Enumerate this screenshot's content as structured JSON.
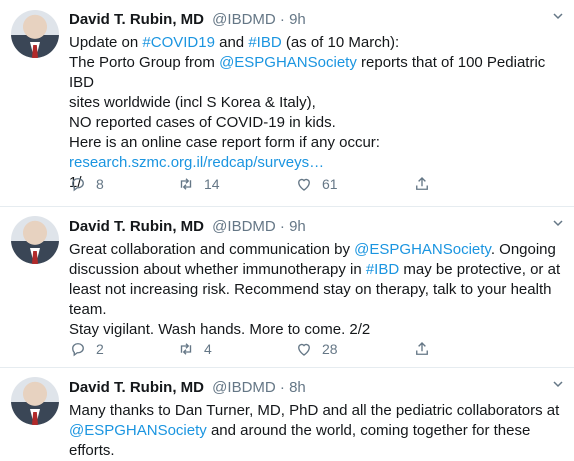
{
  "tweets": [
    {
      "author": "David T. Rubin, MD",
      "handle": "@IBDMD",
      "separator": "·",
      "time": "9h",
      "lines": [
        [
          {
            "t": "Update on "
          },
          {
            "t": "#COVID19",
            "link": true
          },
          {
            "t": " and "
          },
          {
            "t": "#IBD",
            "link": true
          },
          {
            "t": " (as of 10 March):"
          }
        ],
        [
          {
            "t": "The Porto Group from "
          },
          {
            "t": "@ESPGHANSociety",
            "link": true
          },
          {
            "t": " reports that of 100 Pediatric IBD"
          }
        ],
        [
          {
            "t": "sites worldwide (incl S Korea & Italy),"
          }
        ],
        [
          {
            "t": "NO reported cases of COVID-19 in kids."
          }
        ],
        [
          {
            "t": "Here is an online case report form if any occur:"
          }
        ],
        [
          {
            "t": "research.szmc.org.il/redcap/surveys…",
            "link": true
          }
        ],
        [
          {
            "t": "1/"
          }
        ]
      ],
      "replies": "8",
      "retweets": "14",
      "likes": "61"
    },
    {
      "author": "David T. Rubin, MD",
      "handle": "@IBDMD",
      "separator": "·",
      "time": "9h",
      "lines": [
        [
          {
            "t": "Great collaboration and communication by "
          },
          {
            "t": "@ESPGHANSociety",
            "link": true
          },
          {
            "t": ". Ongoing"
          }
        ],
        [
          {
            "t": "discussion about whether immunotherapy in "
          },
          {
            "t": "#IBD",
            "link": true
          },
          {
            "t": " may be protective, or at"
          }
        ],
        [
          {
            "t": "least not increasing risk. Recommend stay on therapy, talk to your health"
          }
        ],
        [
          {
            "t": "team."
          }
        ],
        [
          {
            "t": "Stay vigilant. Wash hands. More to come. 2/2"
          }
        ]
      ],
      "replies": "2",
      "retweets": "4",
      "likes": "28"
    },
    {
      "author": "David T. Rubin, MD",
      "handle": "@IBDMD",
      "separator": "·",
      "time": "8h",
      "lines": [
        [
          {
            "t": "Many thanks to Dan Turner, MD, PhD and all the pediatric collaborators at"
          }
        ],
        [
          {
            "t": "@ESPGHANSociety",
            "link": true
          },
          {
            "t": " and around the world, coming together for these efforts."
          }
        ]
      ]
    }
  ],
  "colors": {
    "link": "#1b95e0",
    "muted": "#657786",
    "text": "#14171a",
    "divider": "#e6ecf0"
  }
}
